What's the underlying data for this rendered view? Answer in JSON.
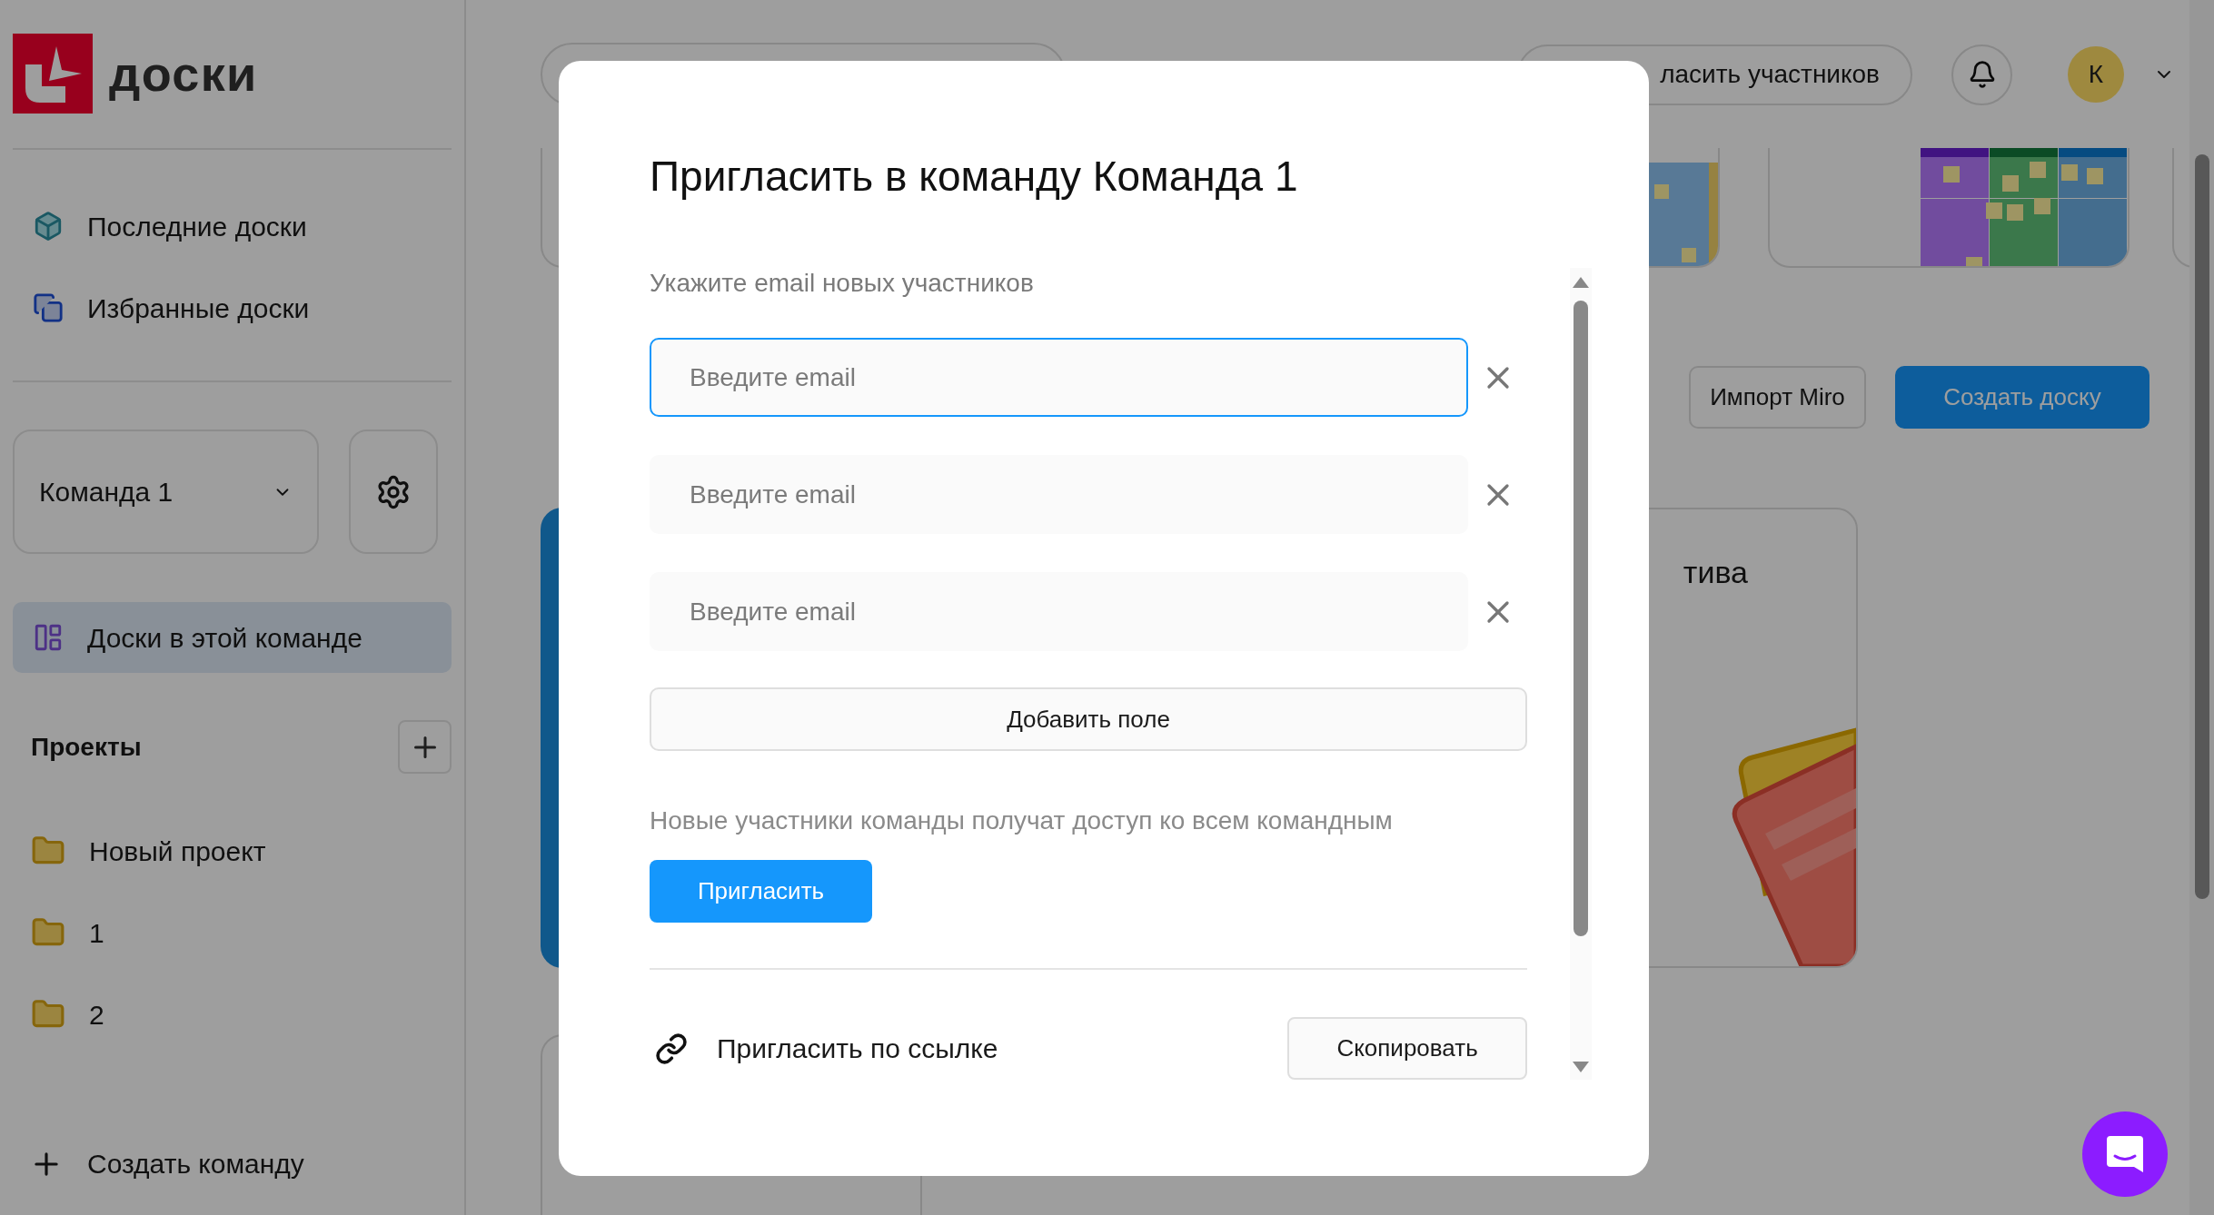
{
  "sidebar": {
    "logo_text": "доски",
    "nav": [
      {
        "label": "Последние доски",
        "kind": "cube",
        "selected": false
      },
      {
        "label": "Избранные доски",
        "kind": "stack",
        "selected": false
      }
    ],
    "team_select": {
      "value": "Команда 1"
    },
    "team_nav": [
      {
        "label": "Доски в этой команде",
        "kind": "board",
        "selected": true
      }
    ],
    "projects": {
      "title": "Проекты",
      "items": [
        {
          "label": "Новый проект"
        },
        {
          "label": "1"
        },
        {
          "label": "2"
        }
      ]
    },
    "create_team": "Создать команду"
  },
  "header": {
    "invite_button": "ласить участников",
    "avatar": "К"
  },
  "content": {
    "buttons": [
      {
        "label": "Импорт Miro",
        "kind": "secondary"
      },
      {
        "label": "Создать доску",
        "kind": "primary"
      }
    ],
    "card_title": "тива"
  },
  "modal": {
    "title": "Пригласить в команду Команда 1",
    "label": "Укажите email новых участников",
    "fields": [
      {
        "placeholder": "Введите email",
        "focused": true
      },
      {
        "placeholder": "Введите email",
        "focused": false
      },
      {
        "placeholder": "Введите email",
        "focused": false
      }
    ],
    "add_field": "Добавить поле",
    "note": "Новые участники команды получат доступ ко всем командным",
    "submit": "Пригласить",
    "link_label": "Пригласить по ссылке",
    "copy": "Скопировать"
  }
}
